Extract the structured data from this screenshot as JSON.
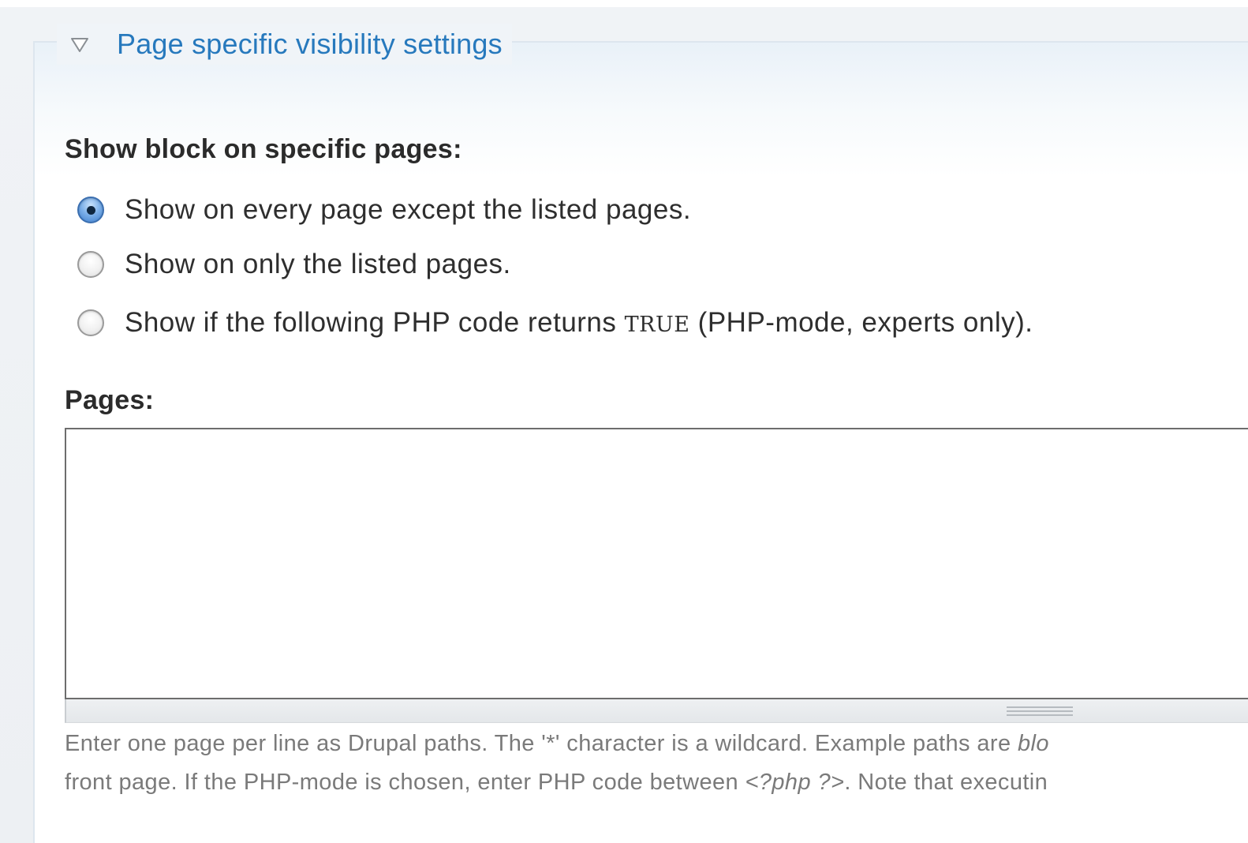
{
  "fieldset": {
    "legend": "Page specific visibility settings",
    "collapsed": false
  },
  "visibility": {
    "heading": "Show block on specific pages:",
    "options": [
      {
        "label": "Show on every page except the listed pages.",
        "selected": true
      },
      {
        "label": "Show on only the listed pages.",
        "selected": false
      },
      {
        "label_before": "Show if the following PHP code returns ",
        "code": "TRUE",
        "label_after": " (PHP-mode, experts only).",
        "selected": false
      }
    ]
  },
  "pages": {
    "label": "Pages:",
    "value": ""
  },
  "description": {
    "line1_text": "Enter one page per line as Drupal paths. The '*' character is a wildcard. Example paths are ",
    "line1_italic": "blo",
    "line2_text": "front page. If the PHP-mode is chosen, enter PHP code between ",
    "line2_code": "<?php ?>",
    "line2_after": ". Note that executin"
  },
  "colors": {
    "legend_link": "#2779bd",
    "radio_selected": "#3f7fce",
    "description_text": "#7a7a7a"
  },
  "icons": {
    "legend_toggle": "triangle-down-icon",
    "resize_handle": "grip-lines-icon"
  }
}
